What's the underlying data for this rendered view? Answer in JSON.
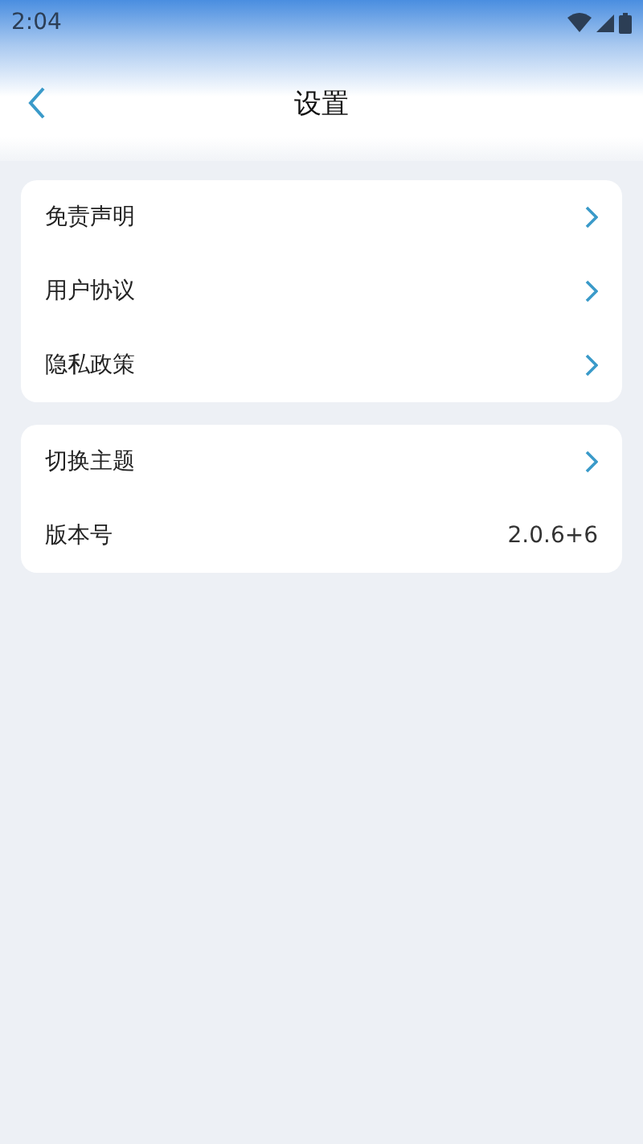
{
  "status_bar": {
    "time": "2:04"
  },
  "header": {
    "title": "设置"
  },
  "groups": [
    {
      "items": [
        {
          "kind": "link",
          "label": "免责声明"
        },
        {
          "kind": "link",
          "label": "用户协议"
        },
        {
          "kind": "link",
          "label": "隐私政策"
        }
      ]
    },
    {
      "items": [
        {
          "kind": "link",
          "label": "切换主题"
        },
        {
          "kind": "value",
          "label": "版本号",
          "value": "2.0.6+6"
        }
      ]
    }
  ]
}
